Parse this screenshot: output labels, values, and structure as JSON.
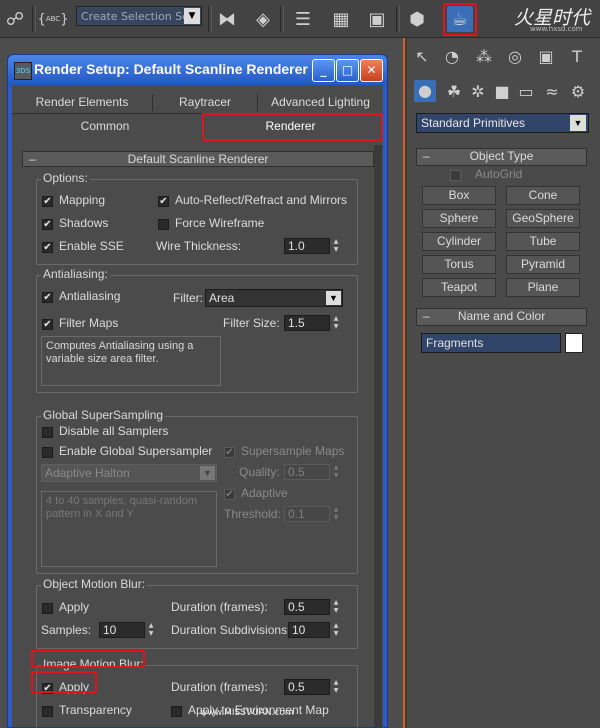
{
  "toolbar": {
    "selection_set_placeholder": "Create Selection Set",
    "abc_label": "ABC"
  },
  "logo": {
    "text": "火星时代",
    "url": "www.hxsd.com"
  },
  "dialog": {
    "title": "Render Setup: Default Scanline Renderer",
    "tabs_row1": [
      "Render Elements",
      "Raytracer",
      "Advanced Lighting"
    ],
    "tabs_row2": [
      "Common",
      "Renderer"
    ],
    "rollout_title": "Default Scanline Renderer",
    "options": {
      "title": "Options:",
      "mapping": "Mapping",
      "auto_reflect": "Auto-Reflect/Refract and Mirrors",
      "shadows": "Shadows",
      "force_wireframe": "Force Wireframe",
      "enable_sse": "Enable SSE",
      "wire_thickness_label": "Wire Thickness:",
      "wire_thickness_value": "1.0"
    },
    "antialiasing": {
      "title": "Antialiasing:",
      "antialiasing": "Antialiasing",
      "filter_label": "Filter:",
      "filter_value": "Area",
      "filter_maps": "Filter Maps",
      "filter_size_label": "Filter Size:",
      "filter_size_value": "1.5",
      "description": "Computes Antialiasing using a variable size area filter."
    },
    "supersampling": {
      "title": "Global SuperSampling",
      "disable_all": "Disable all Samplers",
      "enable_global": "Enable Global Supersampler",
      "supersample_maps": "Supersample Maps",
      "method": "Adaptive Halton",
      "quality_label": "Quality:",
      "quality_value": "0.5",
      "adaptive": "Adaptive",
      "threshold_label": "Threshold:",
      "threshold_value": "0.1",
      "description": "4 to 40 samples, quasi-random pattern in X and Y"
    },
    "object_motion_blur": {
      "title": "Object Motion Blur:",
      "apply": "Apply",
      "duration_label": "Duration (frames):",
      "duration_value": "0.5",
      "samples_label": "Samples:",
      "samples_value": "10",
      "subdivisions_label": "Duration Subdivisions:",
      "subdivisions_value": "10"
    },
    "image_motion_blur": {
      "title": "Image Motion Blur:",
      "apply": "Apply",
      "duration_label": "Duration (frames):",
      "duration_value": "0.5",
      "transparency": "Transparency",
      "apply_env_map": "Apply to Environment Map"
    }
  },
  "command_panel": {
    "category": "Standard Primitives",
    "object_type_title": "Object Type",
    "autogrid": "AutoGrid",
    "objects": [
      "Box",
      "Cone",
      "Sphere",
      "GeoSphere",
      "Cylinder",
      "Tube",
      "Torus",
      "Pyramid",
      "Teapot",
      "Plane"
    ],
    "name_color_title": "Name and Color",
    "name_value": "Fragments"
  },
  "watermark": "www.MISSVUAN.com",
  "colors": {
    "highlight": "#e0141c",
    "title_bar": "#2457c5"
  }
}
